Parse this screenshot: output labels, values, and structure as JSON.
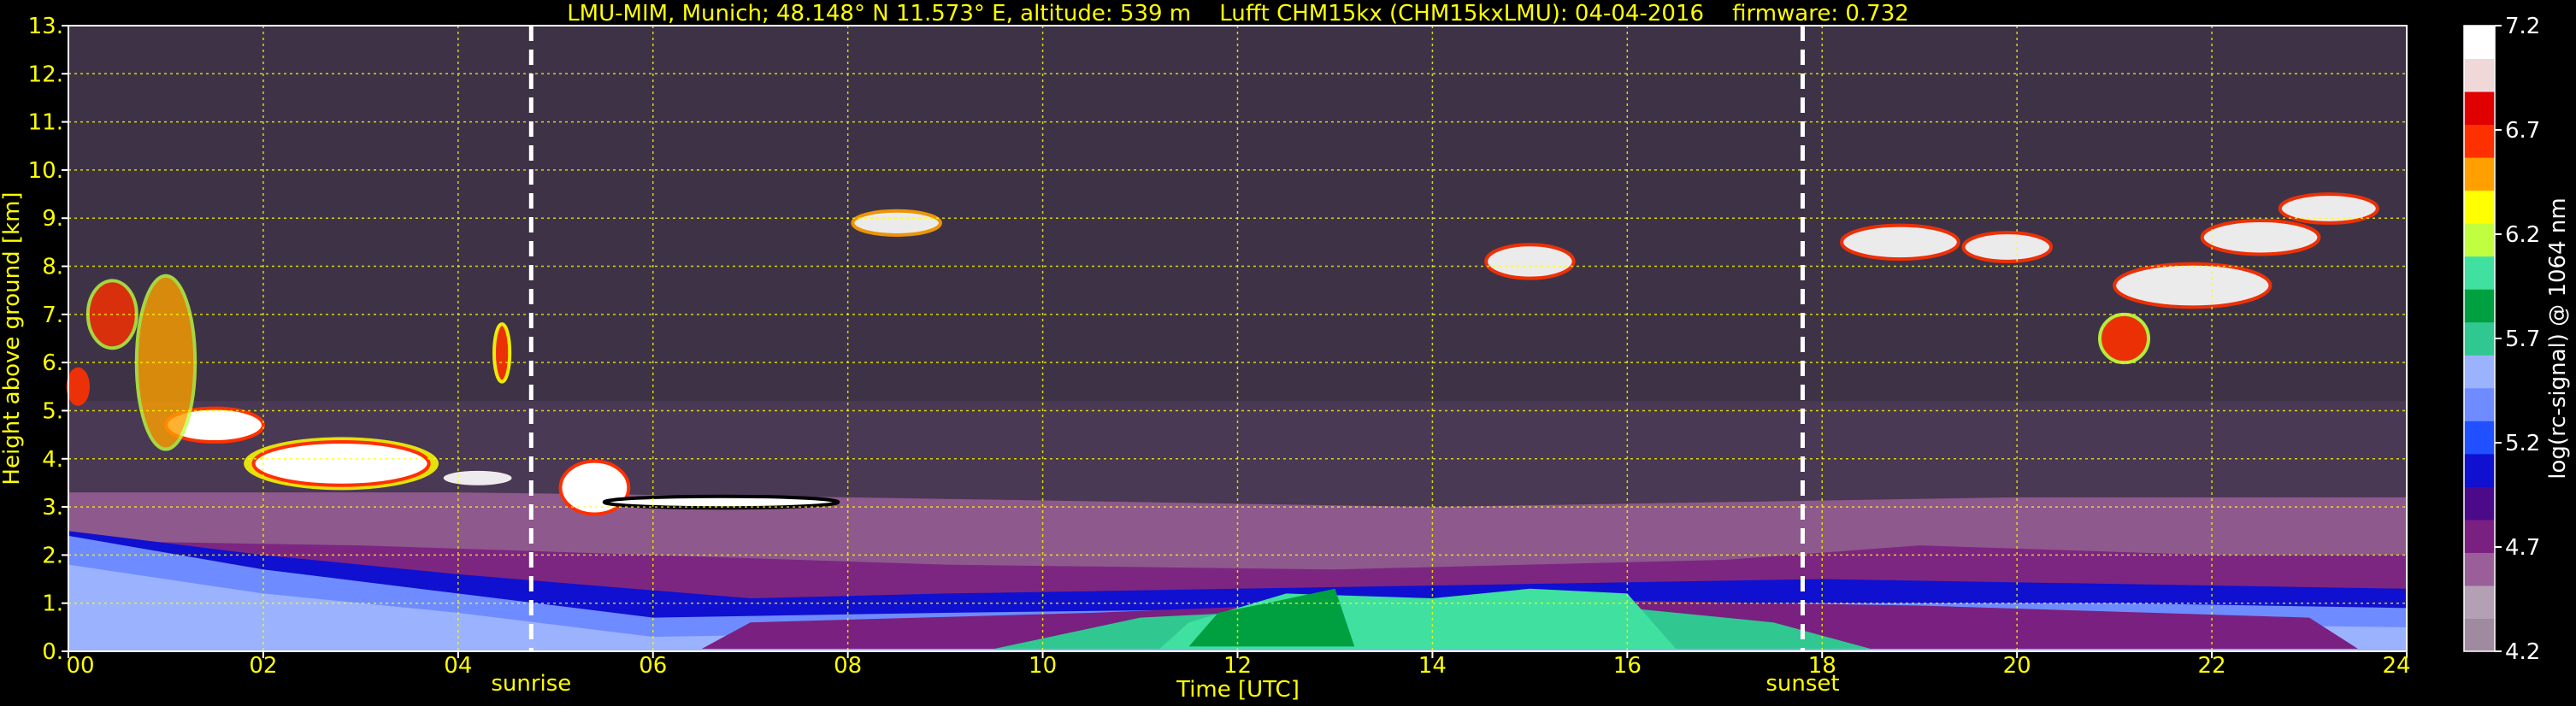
{
  "chart_data": {
    "type": "heatmap",
    "title": "LMU-MIM, Munich; 48.148° N 11.573° E, altitude: 539 m    Lufft CHM15kx (CHM15kxLMU): 04-04-2016    firmware: 0.732",
    "xlabel": "Time [UTC]",
    "ylabel": "Height above ground [km]",
    "colorbar_label": "log(rc-signal) @ 1064 nm",
    "xlim": [
      0,
      24
    ],
    "ylim": [
      0,
      13
    ],
    "x_ticks": [
      0,
      2,
      4,
      6,
      8,
      10,
      12,
      14,
      16,
      18,
      20,
      22,
      24
    ],
    "x_tick_labels": [
      "00",
      "02",
      "04",
      "06",
      "08",
      "10",
      "12",
      "14",
      "16",
      "18",
      "20",
      "22",
      "24"
    ],
    "y_ticks": [
      0,
      1,
      2,
      3,
      4,
      5,
      6,
      7,
      8,
      9,
      10,
      11,
      12,
      13
    ],
    "y_tick_labels": [
      "0.",
      "1.",
      "2.",
      "3.",
      "4.",
      "5.",
      "6.",
      "7.",
      "8.",
      "9.",
      "10.",
      "11.",
      "12.",
      "13."
    ],
    "colorbar_range": [
      4.2,
      7.2
    ],
    "colorbar_ticks": [
      4.2,
      4.7,
      5.2,
      5.7,
      6.2,
      6.7,
      7.2
    ],
    "colorbar_tick_labels": [
      "4.2",
      "4.7",
      "5.2",
      "5.7",
      "6.2",
      "6.7",
      "7.2"
    ],
    "grid": true,
    "markers": [
      {
        "label": "sunrise",
        "x": 4.75
      },
      {
        "label": "sunset",
        "x": 17.8
      }
    ],
    "colormap": [
      "#a08aa0",
      "#b4a0b4",
      "#9a5f98",
      "#7a2080",
      "#4a0a8a",
      "#1010d0",
      "#2050ff",
      "#6e8cff",
      "#9bb2ff",
      "#30c890",
      "#00a040",
      "#40e0a0",
      "#c0ff40",
      "#ffff00",
      "#ffa000",
      "#ff3000",
      "#e00000",
      "#f0d8d8",
      "#ffffff"
    ]
  }
}
